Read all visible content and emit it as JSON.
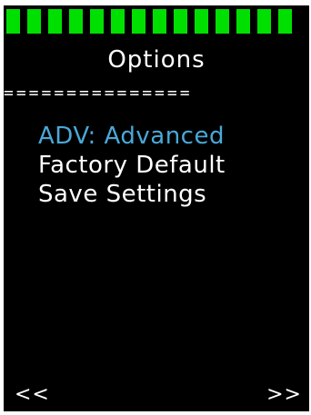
{
  "progress": {
    "segments": 14,
    "color": "#00e000"
  },
  "header": {
    "title": "Options"
  },
  "divider": {
    "text": "==============="
  },
  "menu": {
    "selected_color": "#4aa8d8",
    "items": [
      {
        "label": "ADV: Advanced",
        "selected": true
      },
      {
        "label": "Factory Default",
        "selected": false
      },
      {
        "label": "Save Settings",
        "selected": false
      }
    ]
  },
  "nav": {
    "prev_label": "<<",
    "next_label": ">>"
  }
}
